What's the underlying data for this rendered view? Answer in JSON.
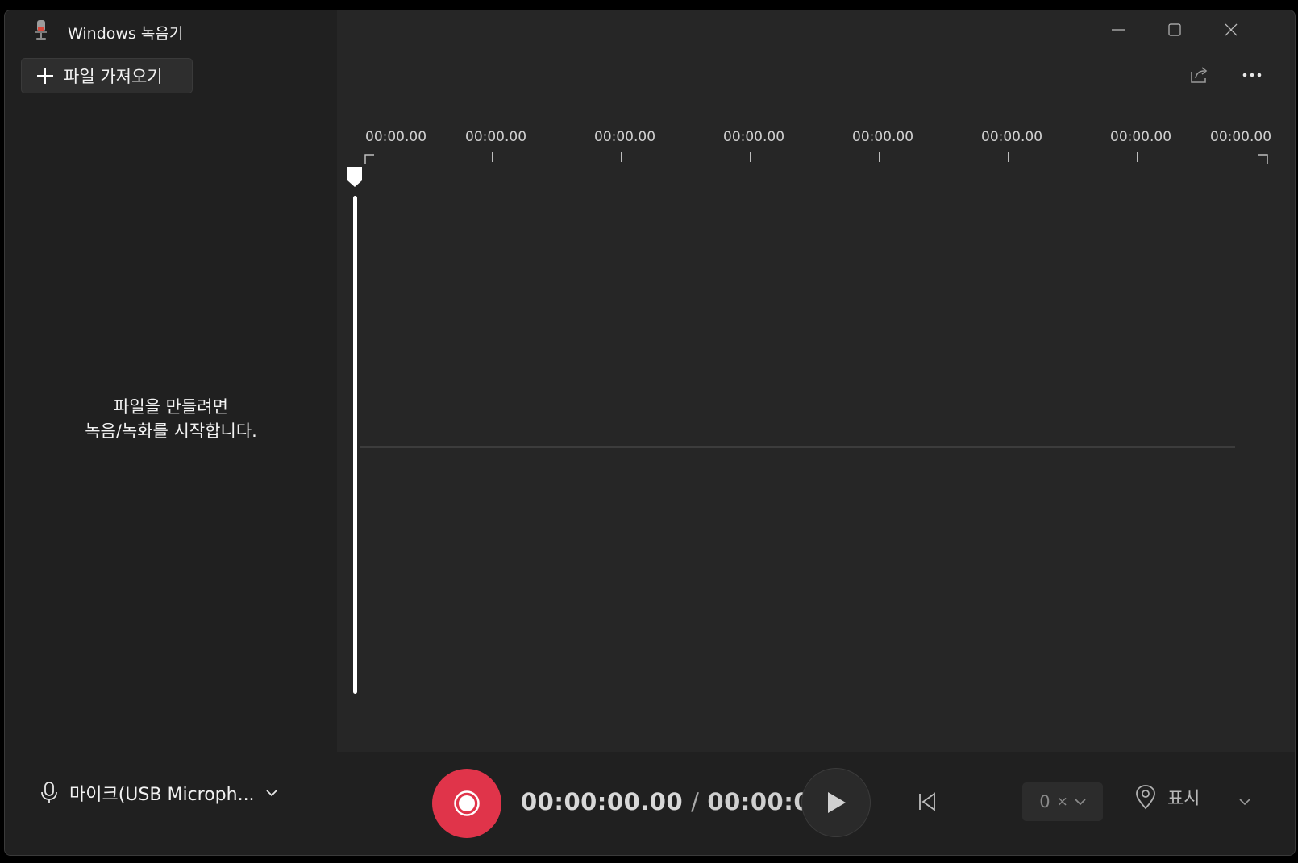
{
  "window": {
    "title": "Windows 녹음기",
    "controls": {
      "minimize": "minimize-icon",
      "maximize": "maximize-icon",
      "close": "close-icon"
    }
  },
  "sidebar": {
    "import_label": "파일 가져오기",
    "empty_line1": "파일을 만들려면",
    "empty_line2": "녹음/녹화를 시작합니다."
  },
  "toolbar": {
    "share_icon": "share-icon",
    "more_icon": "more-icon"
  },
  "timeline": {
    "ticks": [
      "00:00.00",
      "00:00.00",
      "00:00.00",
      "00:00.00",
      "00:00.00",
      "00:00.00",
      "00:00.00",
      "00:00.00"
    ]
  },
  "bottom": {
    "mic_label": "마이크(USB Microph...",
    "current_time": "00:00:00.00",
    "separator": "/",
    "total_time": "00:00:00",
    "speed_value": "0",
    "speed_unit": "×",
    "marker_label": "표시"
  },
  "colors": {
    "record": "#e0344a",
    "background": "#262626",
    "sidebar": "#202020"
  }
}
